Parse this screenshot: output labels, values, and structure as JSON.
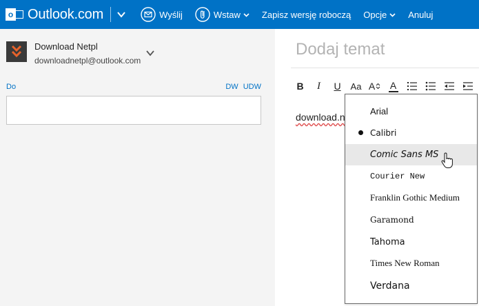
{
  "topbar": {
    "brand": "Outlook.com",
    "send_label": "Wyślij",
    "insert_label": "Wstaw",
    "save_draft_label": "Zapisz wersję roboczą",
    "options_label": "Opcje",
    "cancel_label": "Anuluj",
    "logo_letter": "o"
  },
  "sender": {
    "name": "Download Netpl",
    "email": "downloadnetpl@outlook.com"
  },
  "recipients": {
    "to_label": "Do",
    "cc_label": "DW",
    "bcc_label": "UDW"
  },
  "compose": {
    "subject_placeholder": "Dodaj temat",
    "body_text": "download.n",
    "toolbar": [
      "B",
      "I",
      "U",
      "Aa",
      "A",
      "A"
    ]
  },
  "font_menu": {
    "items": [
      {
        "label": "Arial",
        "font": "Arial"
      },
      {
        "label": "Calibri",
        "font": "Calibri",
        "selected": true
      },
      {
        "label": "Comic Sans MS",
        "font": "Comic Sans MS",
        "hovered": true
      },
      {
        "label": "Courier New",
        "font": "Courier New"
      },
      {
        "label": "Franklin Gothic Medium",
        "font": "Franklin Gothic Medium"
      },
      {
        "label": "Garamond",
        "font": "Garamond"
      },
      {
        "label": "Tahoma",
        "font": "Tahoma"
      },
      {
        "label": "Times New Roman",
        "font": "Times New Roman"
      },
      {
        "label": "Verdana",
        "font": "Verdana"
      }
    ]
  },
  "colors": {
    "brand_blue": "#0072c6",
    "accent_orange": "#e8632b"
  }
}
